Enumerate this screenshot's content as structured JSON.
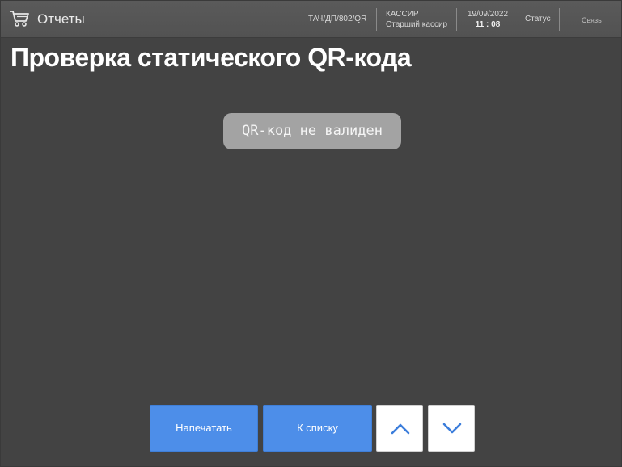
{
  "header": {
    "title": "Отчеты",
    "register_id": "ТАЧ/ДП/802/QR",
    "cashier_role": "КАССИР",
    "cashier_name": "Старший кассир",
    "date": "19/09/2022",
    "time": "11 : 08",
    "status_label": "Статус",
    "connection_label": "Связь",
    "icon": "cart-icon"
  },
  "page": {
    "title": "Проверка статического QR-кода",
    "message": "QR-код не валиден"
  },
  "actions": {
    "print_label": "Напечатать",
    "to_list_label": "К списку",
    "up_icon": "chevron-up-icon",
    "down_icon": "chevron-down-icon"
  },
  "colors": {
    "background": "#434343",
    "header": "#555555",
    "accent": "#4d8ee9",
    "message_bg": "#a3a3a3"
  }
}
